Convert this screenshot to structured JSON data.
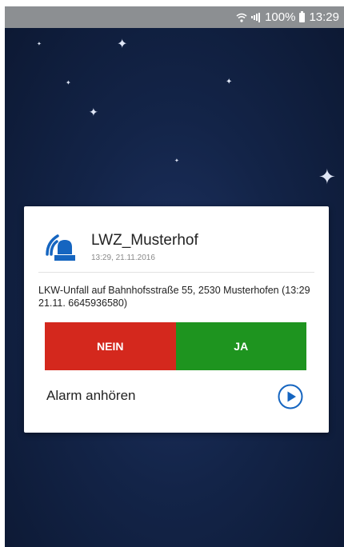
{
  "status_bar": {
    "battery": "100%",
    "time": "13:29"
  },
  "dialog": {
    "icon": "alarm-siren-icon",
    "title": "LWZ_Musterhof",
    "timestamp": "13:29, 21.11.2016",
    "message": "LKW-Unfall auf Bahnhofsstraße 55, 2530 Musterhofen (13:29 21.11. 6645936580)",
    "reject_label": "NEIN",
    "accept_label": "JA",
    "listen_label": "Alarm anhören",
    "play_icon": "play-circle-icon"
  },
  "colors": {
    "status_bar": "#8c8f92",
    "background": "#132448",
    "accent_blue": "#1565c0",
    "reject": "#d4281d",
    "accept": "#1e941f"
  }
}
